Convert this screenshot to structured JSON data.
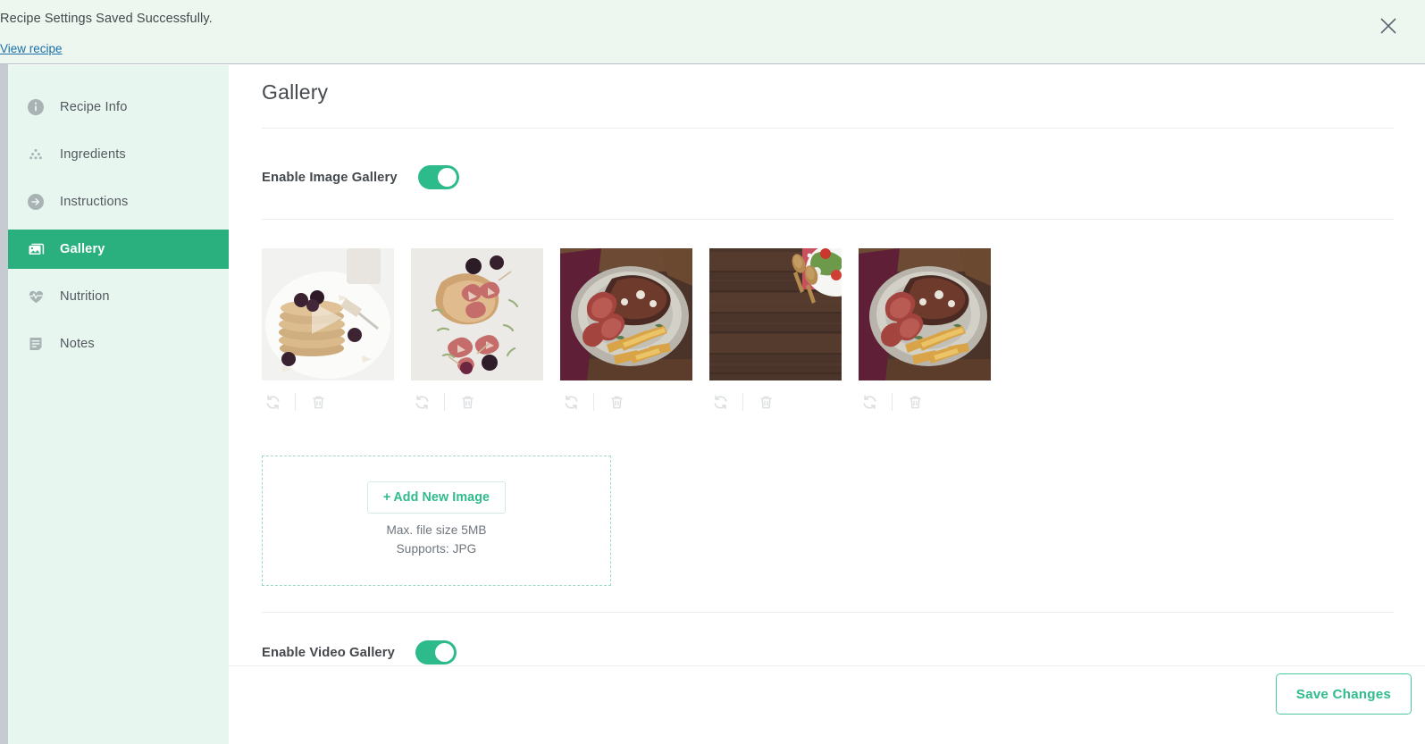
{
  "banner": {
    "message": "Recipe Settings Saved Successfully.",
    "link_label": "View recipe",
    "close_icon": "close-icon",
    "background_color": "#eef7ef",
    "link_color": "#1a6fa8"
  },
  "sidebar": {
    "active_color": "#2ab07f",
    "background_color": "#e8f6f0",
    "items": [
      {
        "label": "Recipe Info",
        "icon": "info-circle-icon",
        "active": false
      },
      {
        "label": "Ingredients",
        "icon": "ingredients-dots-icon",
        "active": false
      },
      {
        "label": "Instructions",
        "icon": "arrow-circle-right-icon",
        "active": false
      },
      {
        "label": "Gallery",
        "icon": "image-icon",
        "active": true
      },
      {
        "label": "Nutrition",
        "icon": "heart-pulse-icon",
        "active": false
      },
      {
        "label": "Notes",
        "icon": "notes-icon",
        "active": false
      }
    ]
  },
  "main": {
    "title": "Gallery",
    "image_gallery": {
      "label": "Enable Image Gallery",
      "enabled": true,
      "toggle_color": "#2ebb8b"
    },
    "video_gallery": {
      "label": "Enable Video Gallery",
      "enabled": true,
      "toggle_color": "#2ebb8b"
    },
    "gallery_images": [
      {
        "alt": "Pancake stack with blackberries and honey on white plate",
        "replace_icon": "refresh-icon",
        "delete_icon": "trash-icon"
      },
      {
        "alt": "Bacon wrapped appetizers on toasted bread with rosemary",
        "replace_icon": "refresh-icon",
        "delete_icon": "trash-icon"
      },
      {
        "alt": "Sliced steak with french fries on metal plate",
        "replace_icon": "refresh-icon",
        "delete_icon": "trash-icon"
      },
      {
        "alt": "Dark wooden table with wooden spoons and salad plate",
        "replace_icon": "refresh-icon",
        "delete_icon": "trash-icon"
      },
      {
        "alt": "Sliced steak with french fries on metal plate",
        "replace_icon": "refresh-icon",
        "delete_icon": "trash-icon"
      }
    ],
    "dropzone": {
      "add_button_label": "Add New Image",
      "add_button_plus": "+",
      "max_size_hint": "Max. file size 5MB",
      "supports_hint": "Supports: JPG",
      "accent_color": "#2fbb8c"
    }
  },
  "footer": {
    "save_label": "Save Changes",
    "accent_color": "#2fbb8c"
  }
}
